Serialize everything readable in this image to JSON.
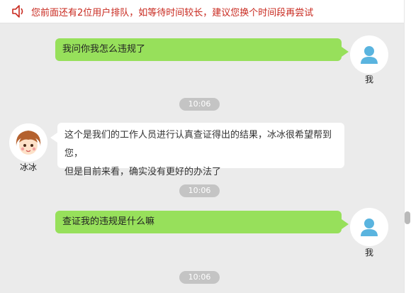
{
  "notice": {
    "text": "您前面还有2位用户排队，如等待时间较长，建议您换个时间段再尝试",
    "icon": "speaker-icon",
    "color": "#c8281e"
  },
  "messages": [
    {
      "sender": "me",
      "sender_label": "我",
      "text": "我问你我怎么违规了"
    },
    {
      "time": "10:06"
    },
    {
      "sender": "agent",
      "sender_label": "冰冰",
      "lines": [
        "这个是我们的工作人员进行认真查证得出的结果，冰冰很希望帮到您，",
        "但是目前来看，确实没有更好的办法了"
      ]
    },
    {
      "time": "10:06"
    },
    {
      "sender": "me",
      "sender_label": "我",
      "text": "查证我的违规是什么嘛"
    },
    {
      "time": "10:06"
    }
  ],
  "colors": {
    "my_bubble": "#97e05b",
    "agent_bubble": "#ffffff",
    "background": "#ebebeb",
    "time_pill": "#c4c4c4",
    "user_avatar": "#5ab4df"
  }
}
